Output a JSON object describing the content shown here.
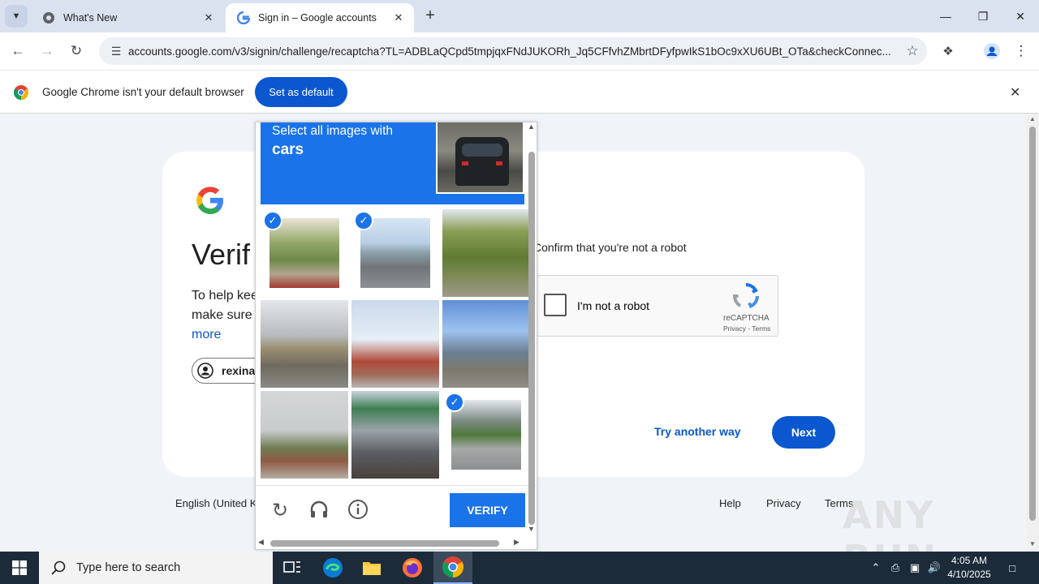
{
  "browser": {
    "tabs": [
      {
        "title": "What's New",
        "active": false
      },
      {
        "title": "Sign in – Google accounts",
        "active": true
      }
    ],
    "url": "accounts.google.com/v3/signin/challenge/recaptcha?TL=ADBLaQCpd5tmpjqxFNdJUKORh_Jq5CFfvhZMbrtDFyfpwIkS1bOc9xXU6UBt_OTa&checkConnec...",
    "infobar": {
      "message": "Google Chrome isn't your default browser",
      "button": "Set as default"
    }
  },
  "page": {
    "heading": "Verif",
    "help_line1": "To help kee",
    "help_line2": "make sure",
    "more_link": "more",
    "account": "rexina",
    "confirm_text": "Confirm that you're not a robot",
    "recaptcha": {
      "checkbox_label": "I'm not a robot",
      "brand": "reCAPTCHA",
      "links": "Privacy - Terms"
    },
    "try_another": "Try another way",
    "next": "Next",
    "footer": {
      "language": "English (United Ki",
      "help": "Help",
      "privacy": "Privacy",
      "terms": "Terms"
    }
  },
  "challenge": {
    "instruction_line1": "Select all images with",
    "instruction_target": "cars",
    "tiles": [
      {
        "index": 1,
        "selected": true
      },
      {
        "index": 2,
        "selected": true
      },
      {
        "index": 3,
        "selected": false
      },
      {
        "index": 4,
        "selected": false
      },
      {
        "index": 5,
        "selected": false
      },
      {
        "index": 6,
        "selected": false
      },
      {
        "index": 7,
        "selected": false
      },
      {
        "index": 8,
        "selected": false
      },
      {
        "index": 9,
        "selected": true
      }
    ],
    "verify_button": "VERIFY"
  },
  "taskbar": {
    "search_placeholder": "Type here to search",
    "time": "4:05 AM",
    "date": "4/10/2025"
  },
  "watermark": "ANY RUN",
  "colors": {
    "google_blue": "#0b57d0",
    "recaptcha_blue": "#1a73e8",
    "page_bg": "#f0f4f9",
    "taskbar": "#1c2b3a"
  }
}
